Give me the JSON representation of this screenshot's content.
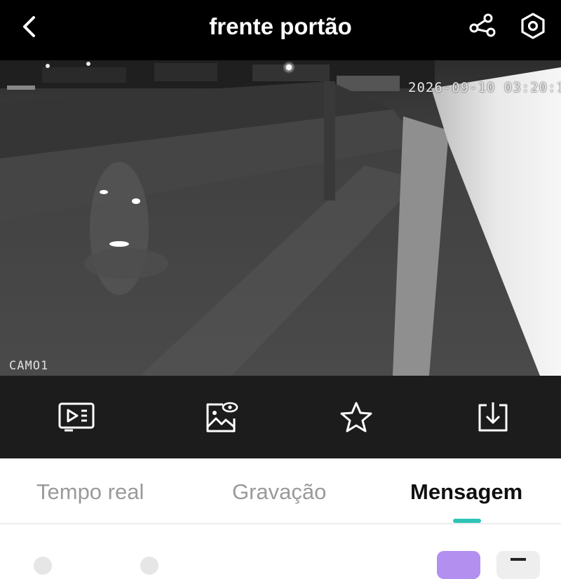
{
  "header": {
    "title": "frente portão",
    "back_icon": "chevron-left-icon",
    "share_icon": "share-icon",
    "settings_icon": "hexagon-settings-icon"
  },
  "video": {
    "timestamp": "2026-09-10 03:20:1",
    "camera_label": "CAMO1"
  },
  "controls": [
    {
      "name": "playback-icon"
    },
    {
      "name": "image-view-icon"
    },
    {
      "name": "star-icon"
    },
    {
      "name": "download-icon"
    }
  ],
  "tabs": {
    "items": [
      {
        "label": "Tempo real"
      },
      {
        "label": "Gravação"
      },
      {
        "label": "Mensagem"
      }
    ],
    "active": "Mensagem",
    "indicator_color": "#2ec4b6"
  },
  "colors": {
    "header_bg": "#000000",
    "controls_bg": "#1c1c1c",
    "accent": "#2ec4b6",
    "purple_button": "#b38ff0"
  }
}
